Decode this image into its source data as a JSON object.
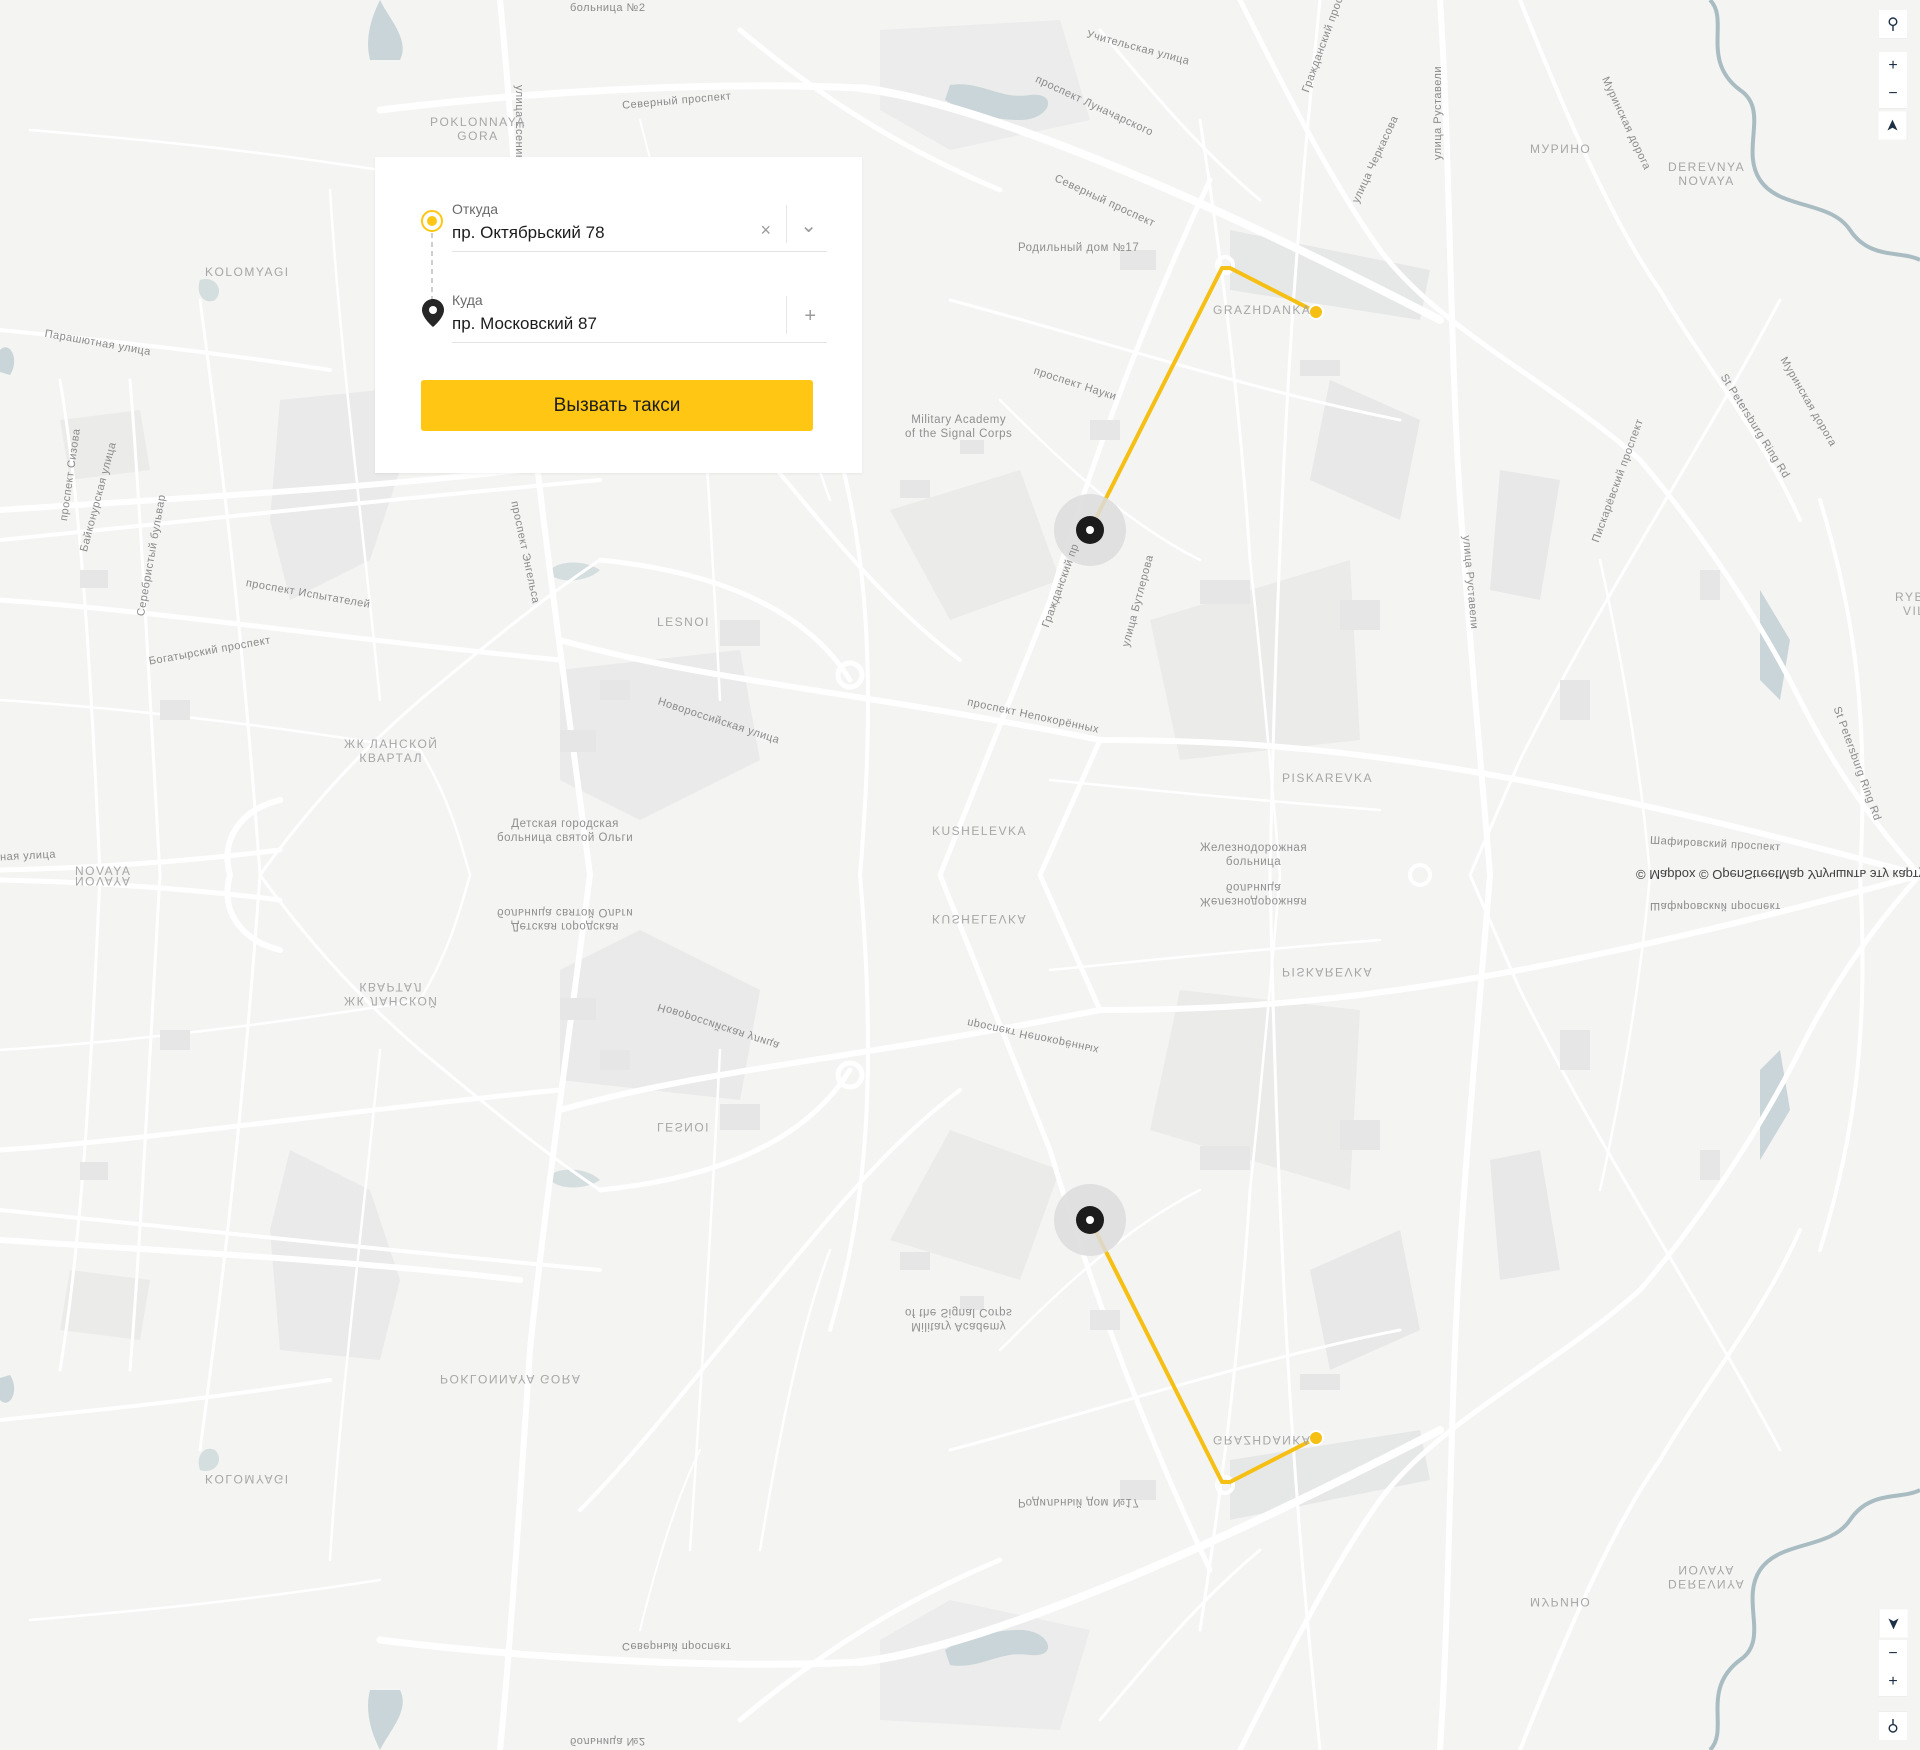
{
  "panel": {
    "from_caption": "Откуда",
    "from_value": "пр. Октябрьский 78",
    "to_caption": "Куда",
    "to_value": "пр. Московский 87",
    "clear_icon": "×",
    "expand_icon": "⌄",
    "add_icon": "+",
    "call_button": "Вызвать такси"
  },
  "map_controls": {
    "search": "⚲",
    "zoom_in": "+",
    "zoom_out": "−",
    "compass": "➤"
  },
  "map_controls_mirrored": {
    "compass": "➤",
    "zoom_out": "−",
    "zoom_in": "+",
    "search": "⚲"
  },
  "colors": {
    "accent": "#ffc714",
    "route": "#f5bf14",
    "map_bg": "#f4f4f3",
    "road": "#ffffff",
    "water": "#c9d5d8",
    "park": "#e8e9e8"
  },
  "attribution": "© Mapbox © OpenStreetMap Улучшить эту карту",
  "labels": {
    "hospital2": "больница №2",
    "esenina": "улица Есенина",
    "severny": "Северный проспект",
    "uchitelskaya": "Учительская улица",
    "lunacharskogo": "проспект Луначарского",
    "grazhdansky_top": "Гражданский просп",
    "rustaveli": "улица Руставели",
    "murino": "МУРИНО",
    "murinskaya": "Муринская дорога",
    "derevnya": "DEREVNYA\nNOVAYA",
    "poklonnaya": "POKLONNAYA\nGORA",
    "kolomyagi": "KOLOMYAGI",
    "severny2": "Северный проспект",
    "rodilny": "Родильный дом №17",
    "cherkasova": "улица Черкасова",
    "grazhdanka": "GRAZHDANKA",
    "parashutnaya": "Парашютная улица",
    "nauki": "проспект Науки",
    "military": "Military Academy\nof the Signal Corps",
    "ringrd": "St Petersburg Ring Rd",
    "murinskaya2": "Муринская дорога",
    "sizova": "проспект Сизова",
    "baikonurskaya": "Байконурская улица",
    "serebristy": "Серебристый бульвар",
    "engelsa": "проспект Энгельса",
    "ispytateley": "проспект Испытателей",
    "lesnoi": "LESNOI",
    "bogatyrsky": "Богатырский проспект",
    "grazhdansky": "Гражданский пр",
    "butlerova": "улица Бутлерова",
    "rustaveli2": "улица Руставели",
    "piskarevsky": "Пискарёвский проспект",
    "rybatskoe": "RYBA\nVIL",
    "novorossiyskaya": "Новороссийская улица",
    "nepokorennykh": "проспект Непокорённых",
    "ringrd2": "St Petersburg Ring Rd",
    "lanskoy": "ЖК ЛАНСКОЙ\nКВАРТАЛ",
    "piskarevka": "PISKAREVKA",
    "kushelevka": "KUSHELEVKA",
    "olga": "Детская городская\nбольница святой Ольги",
    "railway": "Железнодорожная\nбольница",
    "shafirovsky": "Шафировский проспект",
    "novaya": "NOVAYA",
    "ulitsa": "ная улица"
  }
}
